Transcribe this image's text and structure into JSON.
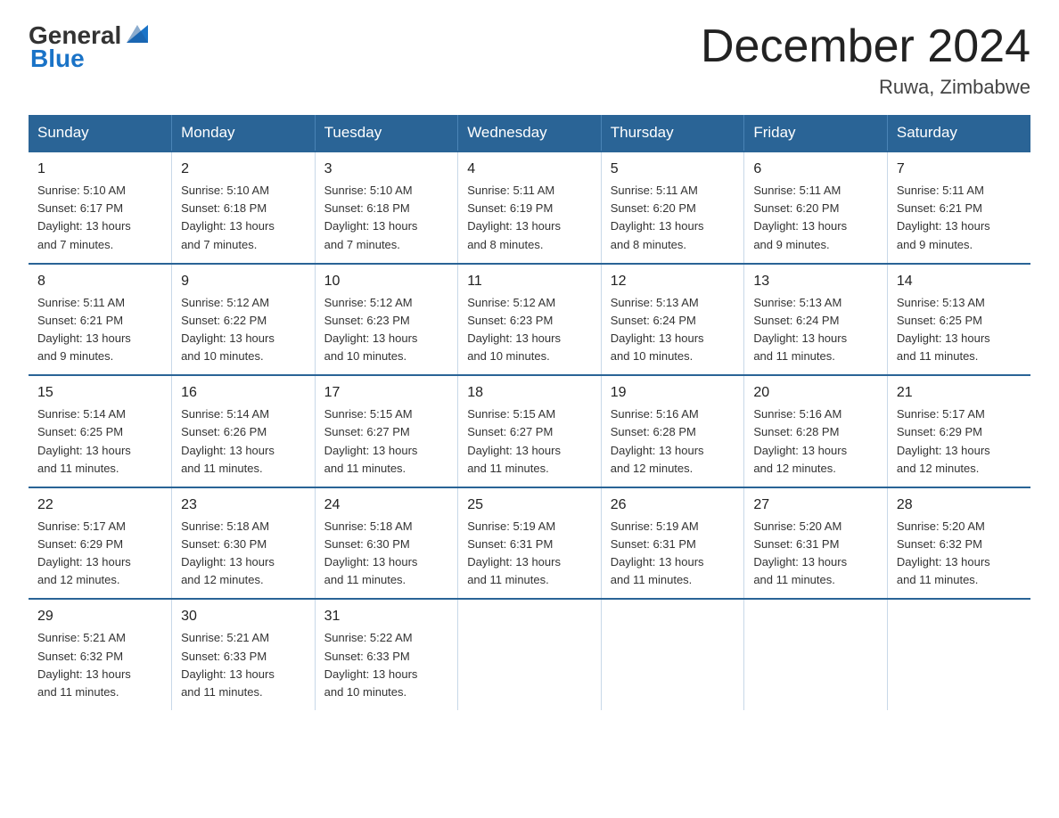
{
  "header": {
    "logo_general": "General",
    "logo_blue": "Blue",
    "month_title": "December 2024",
    "location": "Ruwa, Zimbabwe"
  },
  "weekdays": [
    "Sunday",
    "Monday",
    "Tuesday",
    "Wednesday",
    "Thursday",
    "Friday",
    "Saturday"
  ],
  "weeks": [
    [
      {
        "day": "1",
        "sunrise": "5:10 AM",
        "sunset": "6:17 PM",
        "daylight": "13 hours and 7 minutes."
      },
      {
        "day": "2",
        "sunrise": "5:10 AM",
        "sunset": "6:18 PM",
        "daylight": "13 hours and 7 minutes."
      },
      {
        "day": "3",
        "sunrise": "5:10 AM",
        "sunset": "6:18 PM",
        "daylight": "13 hours and 7 minutes."
      },
      {
        "day": "4",
        "sunrise": "5:11 AM",
        "sunset": "6:19 PM",
        "daylight": "13 hours and 8 minutes."
      },
      {
        "day": "5",
        "sunrise": "5:11 AM",
        "sunset": "6:20 PM",
        "daylight": "13 hours and 8 minutes."
      },
      {
        "day": "6",
        "sunrise": "5:11 AM",
        "sunset": "6:20 PM",
        "daylight": "13 hours and 9 minutes."
      },
      {
        "day": "7",
        "sunrise": "5:11 AM",
        "sunset": "6:21 PM",
        "daylight": "13 hours and 9 minutes."
      }
    ],
    [
      {
        "day": "8",
        "sunrise": "5:11 AM",
        "sunset": "6:21 PM",
        "daylight": "13 hours and 9 minutes."
      },
      {
        "day": "9",
        "sunrise": "5:12 AM",
        "sunset": "6:22 PM",
        "daylight": "13 hours and 10 minutes."
      },
      {
        "day": "10",
        "sunrise": "5:12 AM",
        "sunset": "6:23 PM",
        "daylight": "13 hours and 10 minutes."
      },
      {
        "day": "11",
        "sunrise": "5:12 AM",
        "sunset": "6:23 PM",
        "daylight": "13 hours and 10 minutes."
      },
      {
        "day": "12",
        "sunrise": "5:13 AM",
        "sunset": "6:24 PM",
        "daylight": "13 hours and 10 minutes."
      },
      {
        "day": "13",
        "sunrise": "5:13 AM",
        "sunset": "6:24 PM",
        "daylight": "13 hours and 11 minutes."
      },
      {
        "day": "14",
        "sunrise": "5:13 AM",
        "sunset": "6:25 PM",
        "daylight": "13 hours and 11 minutes."
      }
    ],
    [
      {
        "day": "15",
        "sunrise": "5:14 AM",
        "sunset": "6:25 PM",
        "daylight": "13 hours and 11 minutes."
      },
      {
        "day": "16",
        "sunrise": "5:14 AM",
        "sunset": "6:26 PM",
        "daylight": "13 hours and 11 minutes."
      },
      {
        "day": "17",
        "sunrise": "5:15 AM",
        "sunset": "6:27 PM",
        "daylight": "13 hours and 11 minutes."
      },
      {
        "day": "18",
        "sunrise": "5:15 AM",
        "sunset": "6:27 PM",
        "daylight": "13 hours and 11 minutes."
      },
      {
        "day": "19",
        "sunrise": "5:16 AM",
        "sunset": "6:28 PM",
        "daylight": "13 hours and 12 minutes."
      },
      {
        "day": "20",
        "sunrise": "5:16 AM",
        "sunset": "6:28 PM",
        "daylight": "13 hours and 12 minutes."
      },
      {
        "day": "21",
        "sunrise": "5:17 AM",
        "sunset": "6:29 PM",
        "daylight": "13 hours and 12 minutes."
      }
    ],
    [
      {
        "day": "22",
        "sunrise": "5:17 AM",
        "sunset": "6:29 PM",
        "daylight": "13 hours and 12 minutes."
      },
      {
        "day": "23",
        "sunrise": "5:18 AM",
        "sunset": "6:30 PM",
        "daylight": "13 hours and 12 minutes."
      },
      {
        "day": "24",
        "sunrise": "5:18 AM",
        "sunset": "6:30 PM",
        "daylight": "13 hours and 11 minutes."
      },
      {
        "day": "25",
        "sunrise": "5:19 AM",
        "sunset": "6:31 PM",
        "daylight": "13 hours and 11 minutes."
      },
      {
        "day": "26",
        "sunrise": "5:19 AM",
        "sunset": "6:31 PM",
        "daylight": "13 hours and 11 minutes."
      },
      {
        "day": "27",
        "sunrise": "5:20 AM",
        "sunset": "6:31 PM",
        "daylight": "13 hours and 11 minutes."
      },
      {
        "day": "28",
        "sunrise": "5:20 AM",
        "sunset": "6:32 PM",
        "daylight": "13 hours and 11 minutes."
      }
    ],
    [
      {
        "day": "29",
        "sunrise": "5:21 AM",
        "sunset": "6:32 PM",
        "daylight": "13 hours and 11 minutes."
      },
      {
        "day": "30",
        "sunrise": "5:21 AM",
        "sunset": "6:33 PM",
        "daylight": "13 hours and 11 minutes."
      },
      {
        "day": "31",
        "sunrise": "5:22 AM",
        "sunset": "6:33 PM",
        "daylight": "13 hours and 10 minutes."
      },
      null,
      null,
      null,
      null
    ]
  ],
  "labels": {
    "sunrise": "Sunrise: ",
    "sunset": "Sunset: ",
    "daylight": "Daylight: "
  }
}
